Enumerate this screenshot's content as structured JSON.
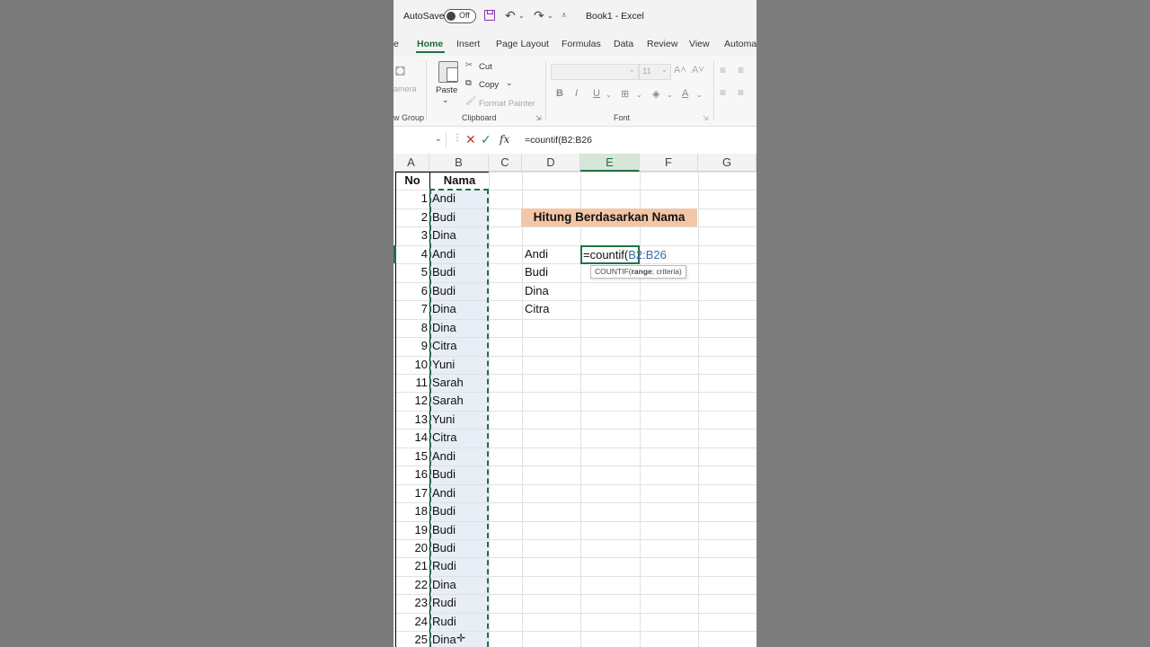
{
  "titlebar": {
    "autosave_label": "AutoSave",
    "autosave_state": "Off",
    "doc_title": "Book1  -  Excel"
  },
  "tabs": [
    "e",
    "Home",
    "Insert",
    "Page Layout",
    "Formulas",
    "Data",
    "Review",
    "View",
    "Automa"
  ],
  "ribbon": {
    "camera_label": "amera",
    "group_left": "w Group",
    "paste": "Paste",
    "cut": "Cut",
    "copy": "Copy",
    "format_painter": "Format Painter",
    "clipboard_group": "Clipboard",
    "font_size": "11",
    "font_group": "Font",
    "bold": "B",
    "italic": "I",
    "underline": "U"
  },
  "formula_bar": {
    "fx": "fx",
    "formula": "=countif(B2:B26"
  },
  "columns": [
    "A",
    "B",
    "C",
    "D",
    "E",
    "F",
    "G"
  ],
  "table": {
    "header_no": "No",
    "header_nama": "Nama",
    "rows": [
      {
        "no": "1",
        "nama": "Andi"
      },
      {
        "no": "2",
        "nama": "Budi"
      },
      {
        "no": "3",
        "nama": "Dina"
      },
      {
        "no": "4",
        "nama": "Andi"
      },
      {
        "no": "5",
        "nama": "Budi"
      },
      {
        "no": "6",
        "nama": "Budi"
      },
      {
        "no": "7",
        "nama": "Dina"
      },
      {
        "no": "8",
        "nama": "Dina"
      },
      {
        "no": "9",
        "nama": "Citra"
      },
      {
        "no": "10",
        "nama": "Yuni"
      },
      {
        "no": "11",
        "nama": "Sarah"
      },
      {
        "no": "12",
        "nama": "Sarah"
      },
      {
        "no": "13",
        "nama": "Yuni"
      },
      {
        "no": "14",
        "nama": "Citra"
      },
      {
        "no": "15",
        "nama": "Andi"
      },
      {
        "no": "16",
        "nama": "Budi"
      },
      {
        "no": "17",
        "nama": "Andi"
      },
      {
        "no": "18",
        "nama": "Budi"
      },
      {
        "no": "19",
        "nama": "Budi"
      },
      {
        "no": "20",
        "nama": "Budi"
      },
      {
        "no": "21",
        "nama": "Rudi"
      },
      {
        "no": "22",
        "nama": "Dina"
      },
      {
        "no": "23",
        "nama": "Rudi"
      },
      {
        "no": "24",
        "nama": "Rudi"
      },
      {
        "no": "25",
        "nama": "Dina"
      }
    ]
  },
  "summary": {
    "title": "Hitung Berdasarkan Nama",
    "names": [
      "Andi",
      "Budi",
      "Dina",
      "Citra"
    ]
  },
  "active_cell": {
    "prefix": "=countif(",
    "ref": "B2:B26"
  },
  "tooltip": {
    "fn": "COUNTIF(",
    "arg_bold": "range",
    "rest": "; criteria)"
  },
  "colors": {
    "accent": "#217346",
    "title_fill": "#f4c6a8"
  }
}
